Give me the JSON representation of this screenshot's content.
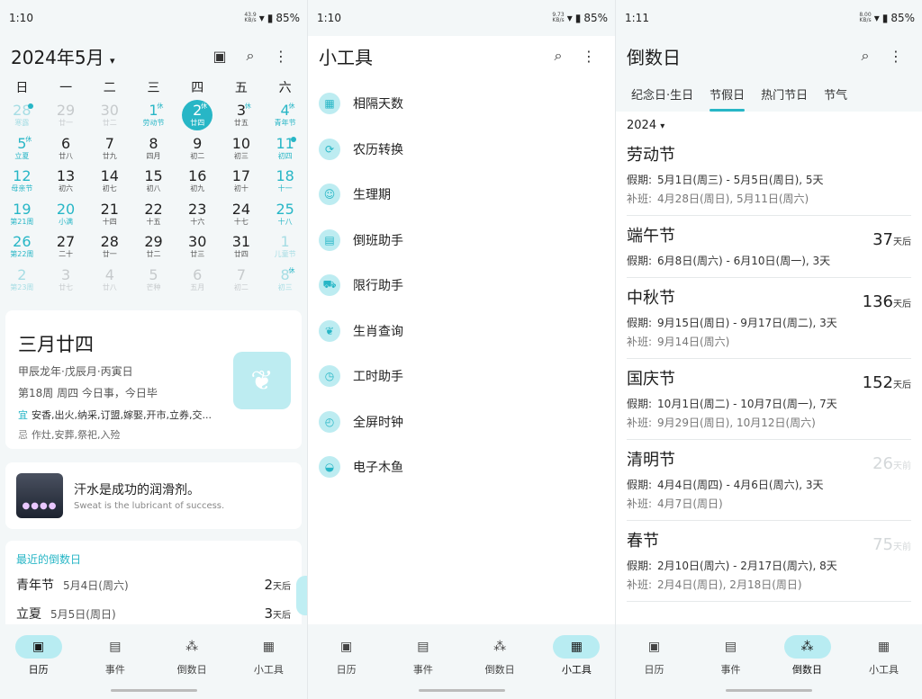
{
  "accent": "#27b6c6",
  "panel1": {
    "status": {
      "time": "1:10",
      "net_top": "43.9",
      "net_bottom": "KB/s",
      "battery": "85%"
    },
    "title": "2024年5月",
    "weekdays": [
      "日",
      "一",
      "二",
      "三",
      "四",
      "五",
      "六"
    ],
    "days": [
      {
        "n": "28",
        "l": "寒露",
        "other": true,
        "hol": true,
        "dot": true
      },
      {
        "n": "29",
        "l": "廿一",
        "other": true
      },
      {
        "n": "30",
        "l": "廿二",
        "other": true
      },
      {
        "n": "1",
        "l": "劳动节",
        "hol": true,
        "badge": "休"
      },
      {
        "n": "2",
        "l": "廿四",
        "today": true,
        "badge": "休"
      },
      {
        "n": "3",
        "l": "廿五",
        "badge": "休"
      },
      {
        "n": "4",
        "l": "青年节",
        "hol": true,
        "badge": "休"
      },
      {
        "n": "5",
        "l": "立夏",
        "hol": true,
        "badge": "休"
      },
      {
        "n": "6",
        "l": "廿八"
      },
      {
        "n": "7",
        "l": "廿九"
      },
      {
        "n": "8",
        "l": "四月"
      },
      {
        "n": "9",
        "l": "初二"
      },
      {
        "n": "10",
        "l": "初三"
      },
      {
        "n": "11",
        "l": "初四",
        "hol": true,
        "dot": true
      },
      {
        "n": "12",
        "l": "母亲节",
        "hol": true
      },
      {
        "n": "13",
        "l": "初六"
      },
      {
        "n": "14",
        "l": "初七"
      },
      {
        "n": "15",
        "l": "初八"
      },
      {
        "n": "16",
        "l": "初九"
      },
      {
        "n": "17",
        "l": "初十"
      },
      {
        "n": "18",
        "l": "十一",
        "hol": true
      },
      {
        "n": "19",
        "l": "第21周",
        "hol": true
      },
      {
        "n": "20",
        "l": "小满",
        "hol": true
      },
      {
        "n": "21",
        "l": "十四"
      },
      {
        "n": "22",
        "l": "十五"
      },
      {
        "n": "23",
        "l": "十六"
      },
      {
        "n": "24",
        "l": "十七"
      },
      {
        "n": "25",
        "l": "十八",
        "hol": true
      },
      {
        "n": "26",
        "l": "第22周",
        "hol": true
      },
      {
        "n": "27",
        "l": "二十"
      },
      {
        "n": "28",
        "l": "廿一"
      },
      {
        "n": "29",
        "l": "廿二"
      },
      {
        "n": "30",
        "l": "廿三"
      },
      {
        "n": "31",
        "l": "廿四"
      },
      {
        "n": "1",
        "l": "儿童节",
        "other": true,
        "hol": true
      },
      {
        "n": "2",
        "l": "第23周",
        "other": true,
        "hol": true
      },
      {
        "n": "3",
        "l": "廿七",
        "other": true
      },
      {
        "n": "4",
        "l": "廿八",
        "other": true
      },
      {
        "n": "5",
        "l": "芒种",
        "other": true
      },
      {
        "n": "6",
        "l": "五月",
        "other": true
      },
      {
        "n": "7",
        "l": "初二",
        "other": true
      },
      {
        "n": "8",
        "l": "初三",
        "other": true,
        "hol": true,
        "badge": "休"
      }
    ],
    "lunar_card": {
      "big": "三月廿四",
      "ganzhi": "甲辰龙年·戊辰月·丙寅日",
      "week": "第18周 周四 今日事，今日毕",
      "yi_label": "宜",
      "yi": "安香,出火,纳采,订盟,嫁娶,开市,立券,交...",
      "ji_label": "忌",
      "ji": "作灶,安葬,祭祀,入殓"
    },
    "quote": {
      "zh": "汗水是成功的润滑剂。",
      "en": "Sweat is the lubricant of success."
    },
    "countdown": {
      "title": "最近的倒数日",
      "items": [
        {
          "name": "青年节",
          "date": "5月4日(周六)",
          "num": "2",
          "unit": "天后"
        },
        {
          "name": "立夏",
          "date": "5月5日(周日)",
          "num": "3",
          "unit": "天后"
        }
      ]
    }
  },
  "panel2": {
    "status": {
      "time": "1:10",
      "net_top": "9.73",
      "net_bottom": "KB/s",
      "battery": "85%"
    },
    "title": "小工具",
    "tools": [
      {
        "label": "相隔天数",
        "icon": "▦",
        "name": "days-between-icon"
      },
      {
        "label": "农历转换",
        "icon": "⟳",
        "name": "lunar-convert-icon"
      },
      {
        "label": "生理期",
        "icon": "☺",
        "name": "period-icon"
      },
      {
        "label": "倒班助手",
        "icon": "▤",
        "name": "shift-icon"
      },
      {
        "label": "限行助手",
        "icon": "⛟",
        "name": "car-icon"
      },
      {
        "label": "生肖查询",
        "icon": "❦",
        "name": "zodiac-icon"
      },
      {
        "label": "工时助手",
        "icon": "◷",
        "name": "work-hours-icon"
      },
      {
        "label": "全屏时钟",
        "icon": "◴",
        "name": "clock-icon"
      },
      {
        "label": "电子木鱼",
        "icon": "◒",
        "name": "wooden-fish-icon"
      }
    ]
  },
  "panel3": {
    "status": {
      "time": "1:11",
      "net_top": "8.00",
      "net_bottom": "KB/s",
      "battery": "85%"
    },
    "title": "倒数日",
    "tabs": [
      "纪念日·生日",
      "节假日",
      "热门节日",
      "节气"
    ],
    "year": "2024",
    "holiday_label": "假期:",
    "makeup_label": "补班:",
    "holidays": [
      {
        "name": "劳动节",
        "count": "",
        "unit": "",
        "past": false,
        "period": "5月1日(周三) - 5月5日(周日), 5天",
        "makeup": "4月28日(周日), 5月11日(周六)"
      },
      {
        "name": "端午节",
        "count": "37",
        "unit": "天后",
        "past": false,
        "period": "6月8日(周六) - 6月10日(周一), 3天",
        "makeup": ""
      },
      {
        "name": "中秋节",
        "count": "136",
        "unit": "天后",
        "past": false,
        "period": "9月15日(周日) - 9月17日(周二), 3天",
        "makeup": "9月14日(周六)"
      },
      {
        "name": "国庆节",
        "count": "152",
        "unit": "天后",
        "past": false,
        "period": "10月1日(周二) - 10月7日(周一), 7天",
        "makeup": "9月29日(周日), 10月12日(周六)"
      },
      {
        "name": "清明节",
        "count": "26",
        "unit": "天前",
        "past": true,
        "period": "4月4日(周四) - 4月6日(周六), 3天",
        "makeup": "4月7日(周日)"
      },
      {
        "name": "春节",
        "count": "75",
        "unit": "天前",
        "past": true,
        "period": "2月10日(周六) - 2月17日(周六), 8天",
        "makeup": "2月4日(周日), 2月18日(周日)"
      }
    ]
  },
  "nav": {
    "items": [
      {
        "label": "日历",
        "icon": "▣",
        "name": "calendar-nav-icon"
      },
      {
        "label": "事件",
        "icon": "▤",
        "name": "events-nav-icon"
      },
      {
        "label": "倒数日",
        "icon": "⁂",
        "name": "countdown-nav-icon"
      },
      {
        "label": "小工具",
        "icon": "▦",
        "name": "tools-nav-icon"
      }
    ],
    "active": [
      0,
      3,
      2
    ]
  }
}
